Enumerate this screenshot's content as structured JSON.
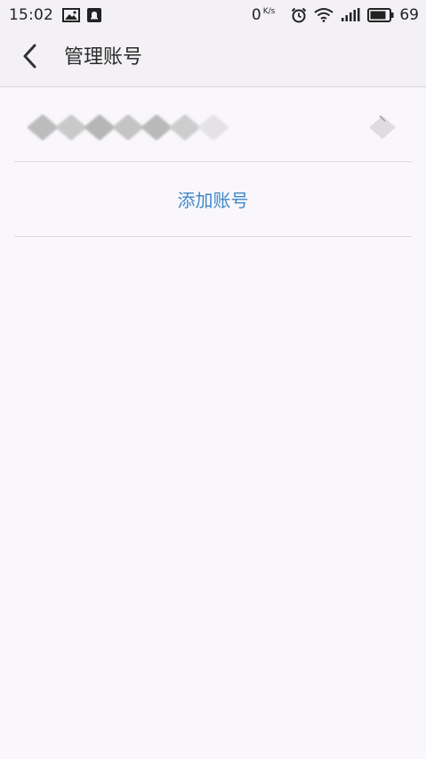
{
  "status_bar": {
    "time": "15:02",
    "left_icons": [
      "image-icon",
      "notification-icon"
    ],
    "data_speed": "0",
    "data_speed_unit": "K/s",
    "right_icons": [
      "alarm-icon",
      "wifi-icon",
      "signal-icon",
      "battery-icon"
    ],
    "battery_level": "69"
  },
  "app_bar": {
    "back_icon": "chevron-left-icon",
    "title": "管理账号"
  },
  "account": {
    "name": "",
    "name_obscured": true
  },
  "actions": {
    "add_account_label": "添加账号"
  },
  "colors": {
    "background": "#f9f7fb",
    "bar_background": "#f3f1f5",
    "accent_link": "#3f87c9",
    "divider": "#dcdadf"
  }
}
